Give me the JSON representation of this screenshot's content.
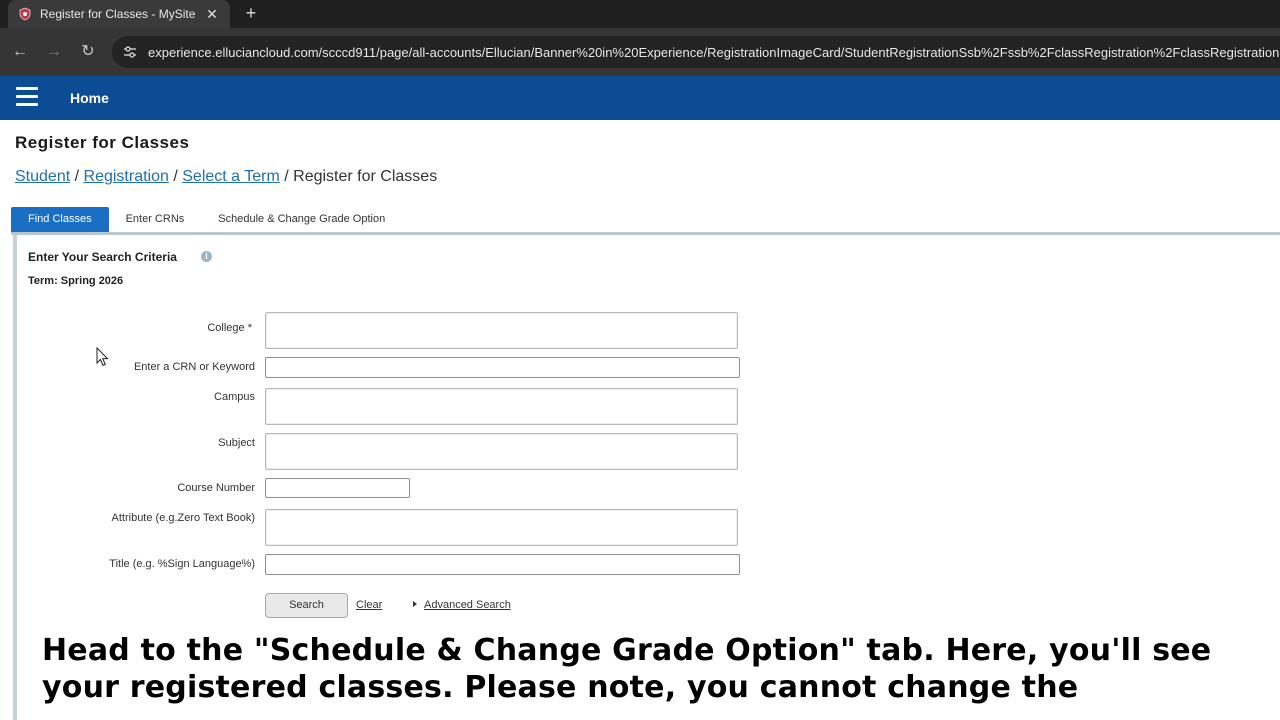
{
  "browser": {
    "tab_title": "Register for Classes - MySite",
    "tab_close": "✕",
    "new_tab": "+",
    "url": "experience.elluciancloud.com/scccd911/page/all-accounts/Ellucian/Banner%20in%20Experience/RegistrationImageCard/StudentRegistrationSsb%2Fssb%2FclassRegistration%2FclassRegistration",
    "back_icon": "←",
    "forward_icon": "→",
    "reload_icon": "↻"
  },
  "appbar": {
    "home_label": "Home"
  },
  "page": {
    "title": "Register for Classes",
    "breadcrumb": {
      "student": "Student",
      "registration": "Registration",
      "select_term": "Select a Term",
      "current": "Register for Classes",
      "sep": "/"
    }
  },
  "tabs": [
    {
      "label": "Find Classes",
      "active": true
    },
    {
      "label": "Enter CRNs",
      "active": false
    },
    {
      "label": "Schedule & Change Grade Option",
      "active": false
    }
  ],
  "search": {
    "heading": "Enter Your Search Criteria",
    "info_glyph": "i",
    "term": "Term: Spring 2026",
    "fields": {
      "college": "College *",
      "crn_keyword": "Enter a CRN or Keyword",
      "campus": "Campus",
      "subject": "Subject",
      "course_number": "Course Number",
      "attribute": "Attribute (e.g.Zero Text Book)",
      "title": "Title (e.g. %Sign Language%)"
    },
    "search_button": "Search",
    "clear_link": "Clear",
    "advanced_link": "Advanced Search"
  },
  "caption": {
    "line1": "Head to the \"Schedule & Change Grade Option\" tab. Here, you'll see",
    "line2": "your registered classes. Please note, you cannot change the"
  },
  "colors": {
    "appbar": "#0c4c95",
    "active_tab": "#1a6fc4",
    "link": "#1f6fb2"
  }
}
